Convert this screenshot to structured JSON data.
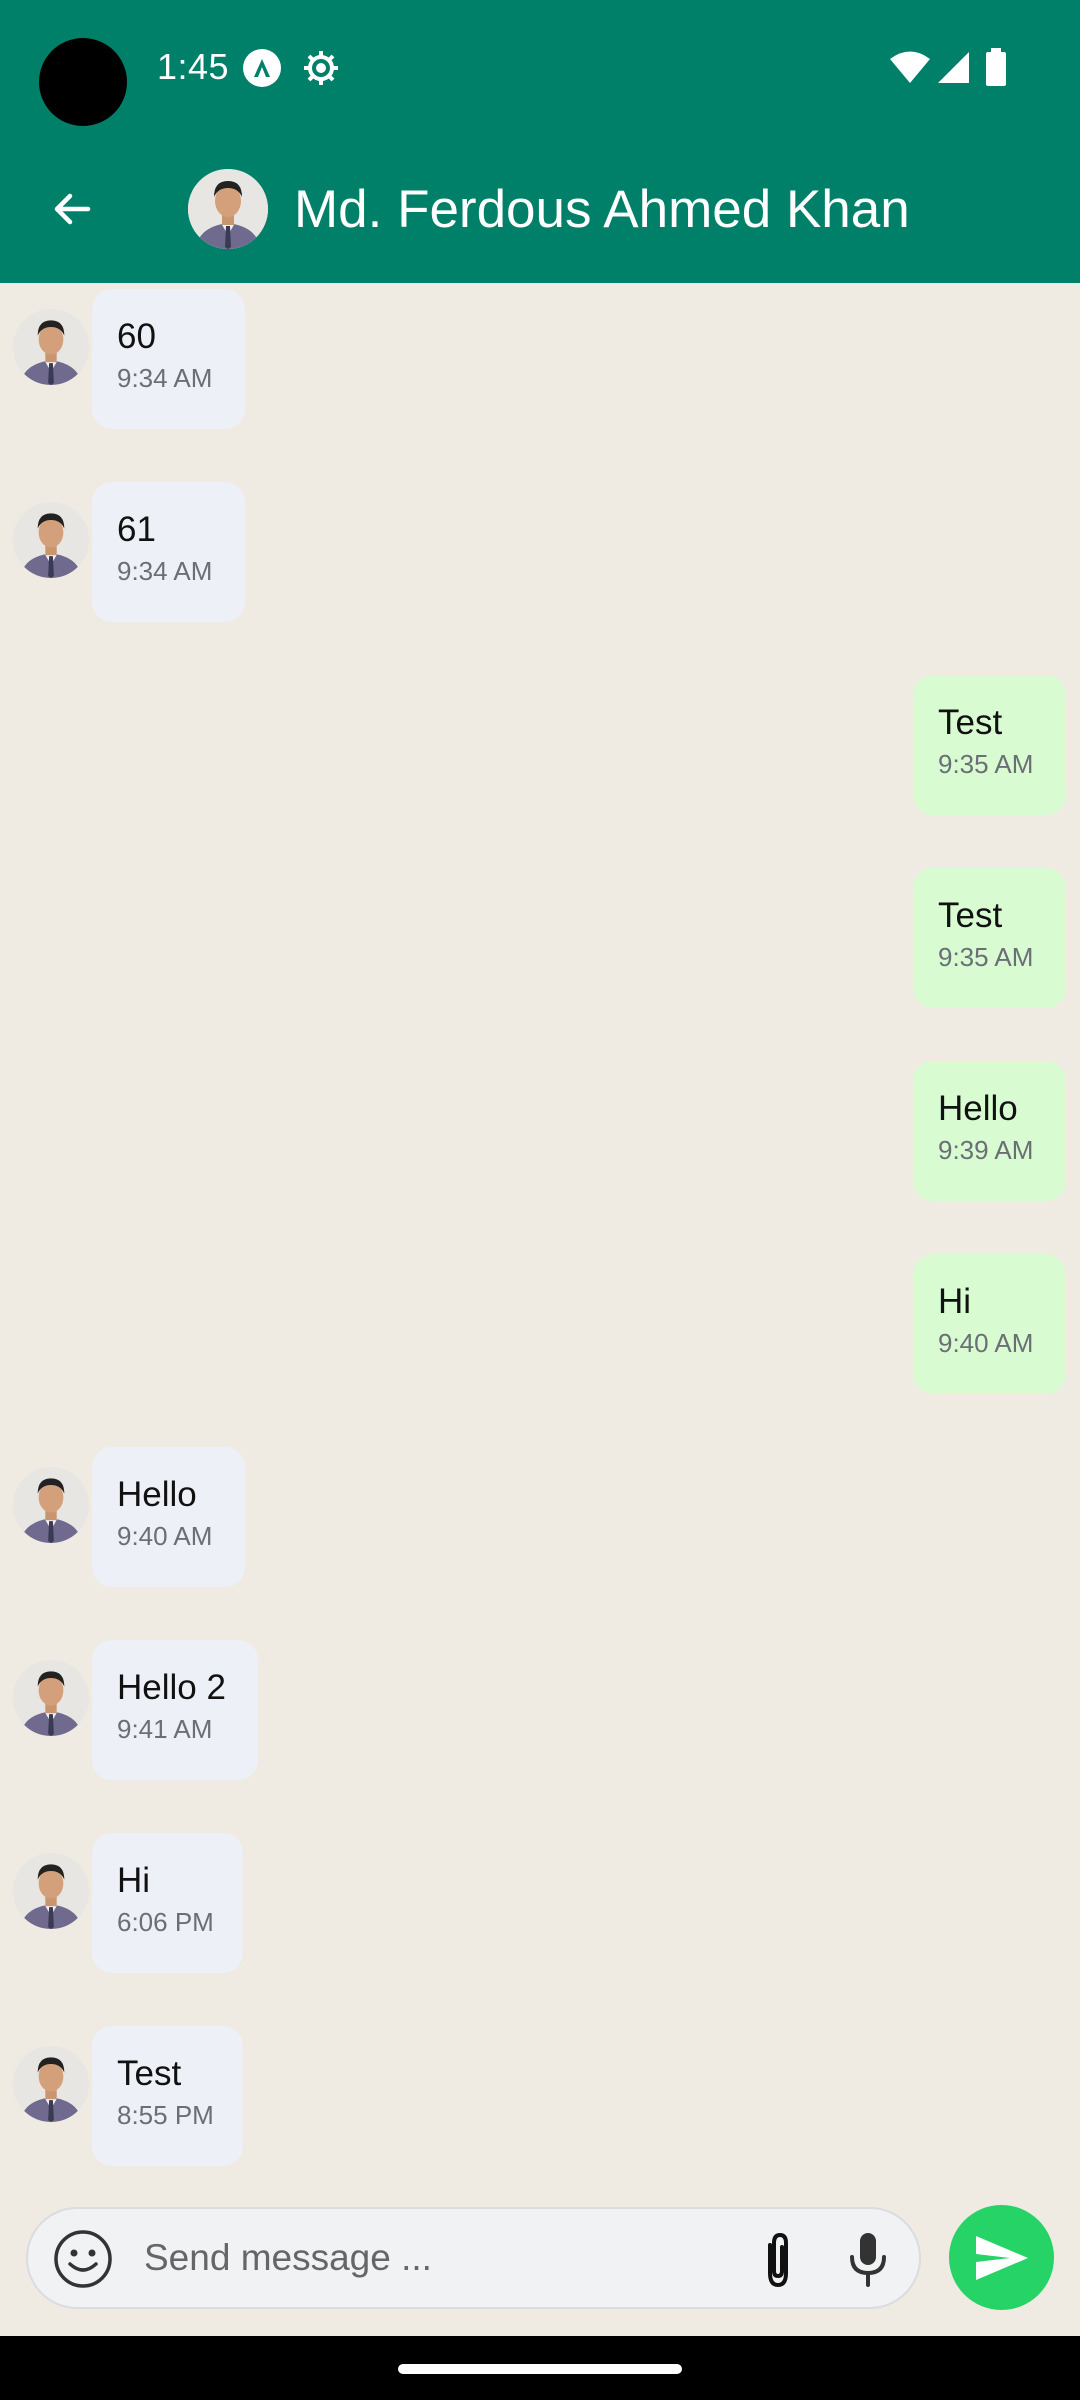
{
  "status_bar": {
    "time": "1:45"
  },
  "header": {
    "contact_name": "Md. Ferdous Ahmed Khan"
  },
  "messages": [
    {
      "direction": "in",
      "text": "60",
      "time": "9:34 AM"
    },
    {
      "direction": "in",
      "text": "61",
      "time": "9:34 AM"
    },
    {
      "direction": "out",
      "text": "Test",
      "time": "9:35 AM"
    },
    {
      "direction": "out",
      "text": "Test",
      "time": "9:35 AM"
    },
    {
      "direction": "out",
      "text": "Hello",
      "time": "9:39 AM"
    },
    {
      "direction": "out",
      "text": "Hi",
      "time": "9:40 AM"
    },
    {
      "direction": "in",
      "text": "Hello",
      "time": "9:40 AM"
    },
    {
      "direction": "in",
      "text": "Hello 2",
      "time": "9:41 AM"
    },
    {
      "direction": "in",
      "text": "Hi",
      "time": "6:06 PM"
    },
    {
      "direction": "in",
      "text": "Test",
      "time": "8:55 PM"
    }
  ],
  "composer": {
    "placeholder": "Send message ..."
  },
  "colors": {
    "header": "#008069",
    "chat_bg": "#efeae2",
    "incoming": "#eef0f7",
    "outgoing": "#d8fbd2",
    "send": "#25d366"
  },
  "icons": [
    "back-arrow-icon",
    "emoji-icon",
    "attach-icon",
    "mic-icon",
    "send-icon",
    "wifi-icon",
    "signal-icon",
    "battery-icon",
    "settings-gear-icon",
    "app-notification-icon"
  ]
}
